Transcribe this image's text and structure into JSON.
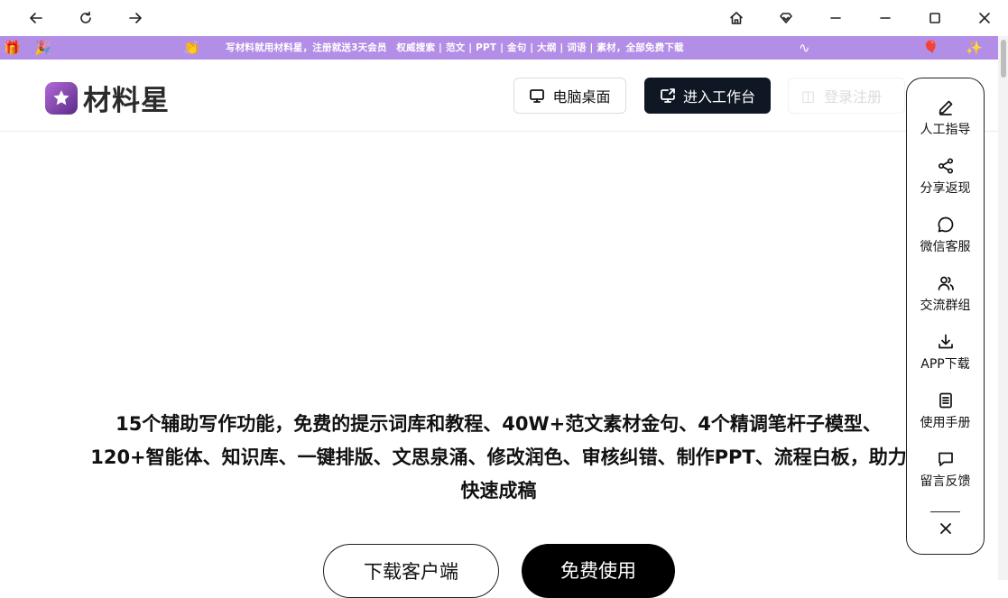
{
  "banner": {
    "text": "写材料就用材料星，注册就送3天会员　权威搜索 | 范文 | PPT | 金句 | 大纲 | 词语 | 素材，全部免费下载"
  },
  "header": {
    "logo_text": "材料星",
    "desktop_button": "电脑桌面",
    "workspace_button": "进入工作台",
    "faded_button": "登录注册"
  },
  "hero": {
    "description": "15个辅助写作功能，免费的提示词库和教程、40W+范文素材金句、4个精调笔杆子模型、120+智能体、知识库、一键排版、文思泉涌、修改润色、审核纠错、制作PPT、流程白板，助力快速成稿",
    "download_button": "下载客户端",
    "free_button": "免费使用"
  },
  "side_panel": {
    "items": [
      {
        "label": "人工指导",
        "icon": "pen-icon"
      },
      {
        "label": "分享返现",
        "icon": "share-icon"
      },
      {
        "label": "微信客服",
        "icon": "chat-bubble-icon"
      },
      {
        "label": "交流群组",
        "icon": "users-icon"
      },
      {
        "label": "APP下载",
        "icon": "download-icon"
      },
      {
        "label": "使用手册",
        "icon": "manual-icon"
      },
      {
        "label": "留言反馈",
        "icon": "message-icon"
      }
    ]
  },
  "colors": {
    "banner": "#b38ee6",
    "dark_button": "#0f1724",
    "free_button": "#000000"
  }
}
